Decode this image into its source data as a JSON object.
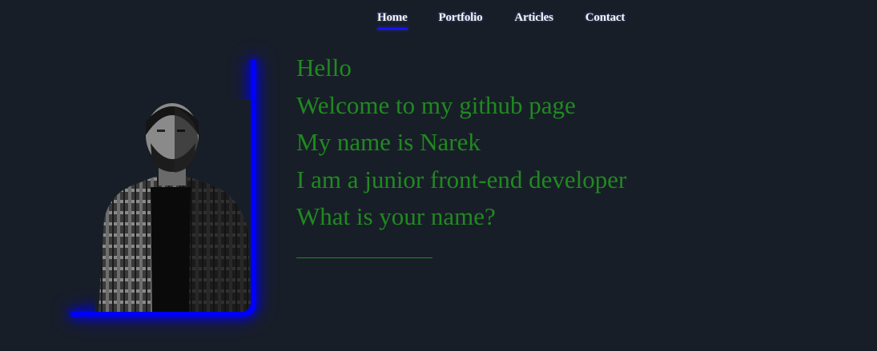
{
  "nav": {
    "items": [
      {
        "label": "Home",
        "active": true
      },
      {
        "label": "Portfolio"
      },
      {
        "label": "Articles"
      },
      {
        "label": "Contact"
      }
    ]
  },
  "intro": {
    "lines": [
      "Hello",
      "Welcome to my github page",
      "My name is Narek",
      "I am a junior front-end developer",
      "What is your name?"
    ]
  },
  "name_input": {
    "value": "",
    "placeholder": ""
  },
  "colors": {
    "background": "#181e28",
    "text_green": "#1f8a1f",
    "accent_blue": "#0000ff",
    "nav_text": "#f4f4f4"
  },
  "icons": {
    "photo": "profile-photo"
  }
}
